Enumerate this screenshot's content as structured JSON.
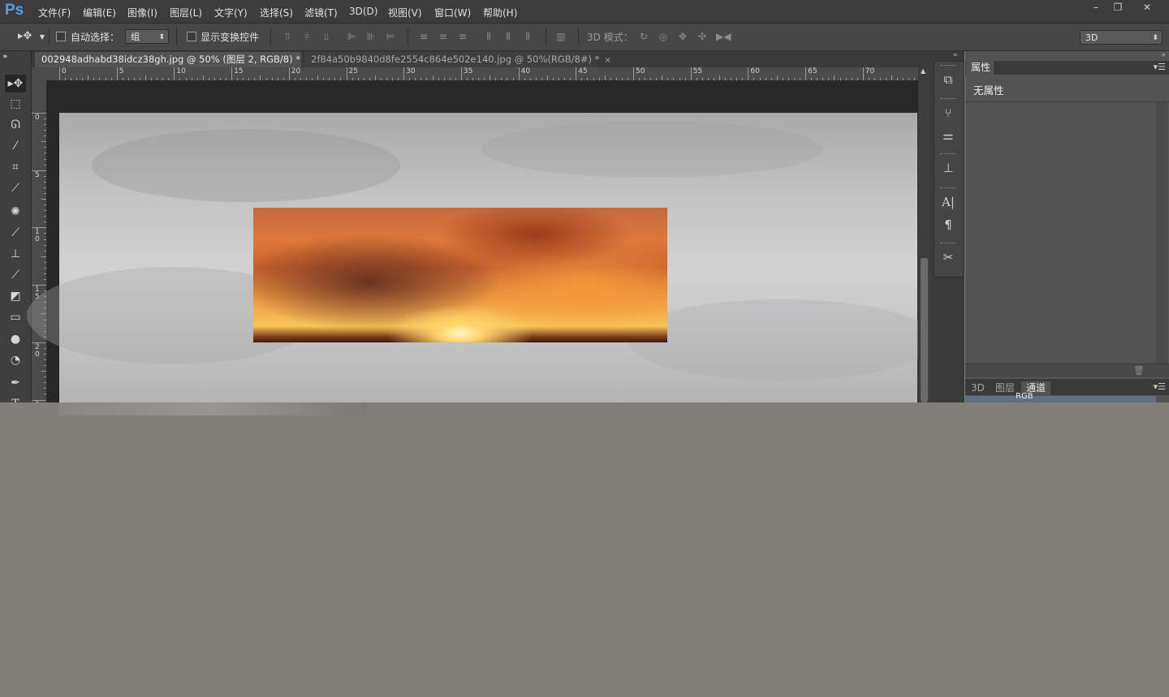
{
  "app": {
    "logo": "Ps"
  },
  "menubar": {
    "items": [
      "文件(F)",
      "编辑(E)",
      "图像(I)",
      "图层(L)",
      "文字(Y)",
      "选择(S)",
      "滤镜(T)",
      "3D(D)",
      "视图(V)",
      "窗口(W)",
      "帮助(H)"
    ],
    "window_controls": {
      "minimize": "–",
      "restore": "❐",
      "close": "✕"
    }
  },
  "options": {
    "auto_select_label": "自动选择：",
    "auto_select_value": "组",
    "show_transform_label": "显示变换控件",
    "mode3d_label": "3D 模式：",
    "workspace_value": "3D"
  },
  "tabs": [
    {
      "title": "002948adhabd38idcz38gh.jpg @ 50% (图层 2, RGB/8) *",
      "close": "×"
    },
    {
      "title": "2f84a50b9840d8fe2554c864e502e140.jpg @ 50%(RGB/8#) *",
      "close": "×"
    }
  ],
  "ruler": {
    "h_labels": [
      "0",
      "5",
      "10",
      "15",
      "20",
      "25",
      "30",
      "35",
      "40",
      "45",
      "50",
      "55",
      "60",
      "65",
      "70"
    ],
    "v_labels": [
      "0",
      "5",
      "1\n0",
      "1\n5",
      "2\n0",
      "2\n5"
    ]
  },
  "properties": {
    "tab": "属性",
    "no_properties": "无属性"
  },
  "layers": {
    "tabs": [
      "3D",
      "图层",
      "通道"
    ],
    "row_label": "RGB"
  },
  "icons": {
    "move_tool": "move-icon",
    "marquee": "marquee-icon",
    "lasso": "lasso-icon",
    "quick_select": "wand-icon",
    "crop": "crop-icon",
    "eyedropper": "eyedropper-icon",
    "healing": "healing-icon",
    "brush": "brush-icon",
    "stamp": "stamp-icon",
    "history_brush": "history-brush-icon",
    "eraser": "eraser-icon",
    "gradient": "gradient-icon",
    "blur": "blur-icon",
    "dodge": "dodge-icon",
    "pen": "pen-icon",
    "type": "type-icon"
  }
}
